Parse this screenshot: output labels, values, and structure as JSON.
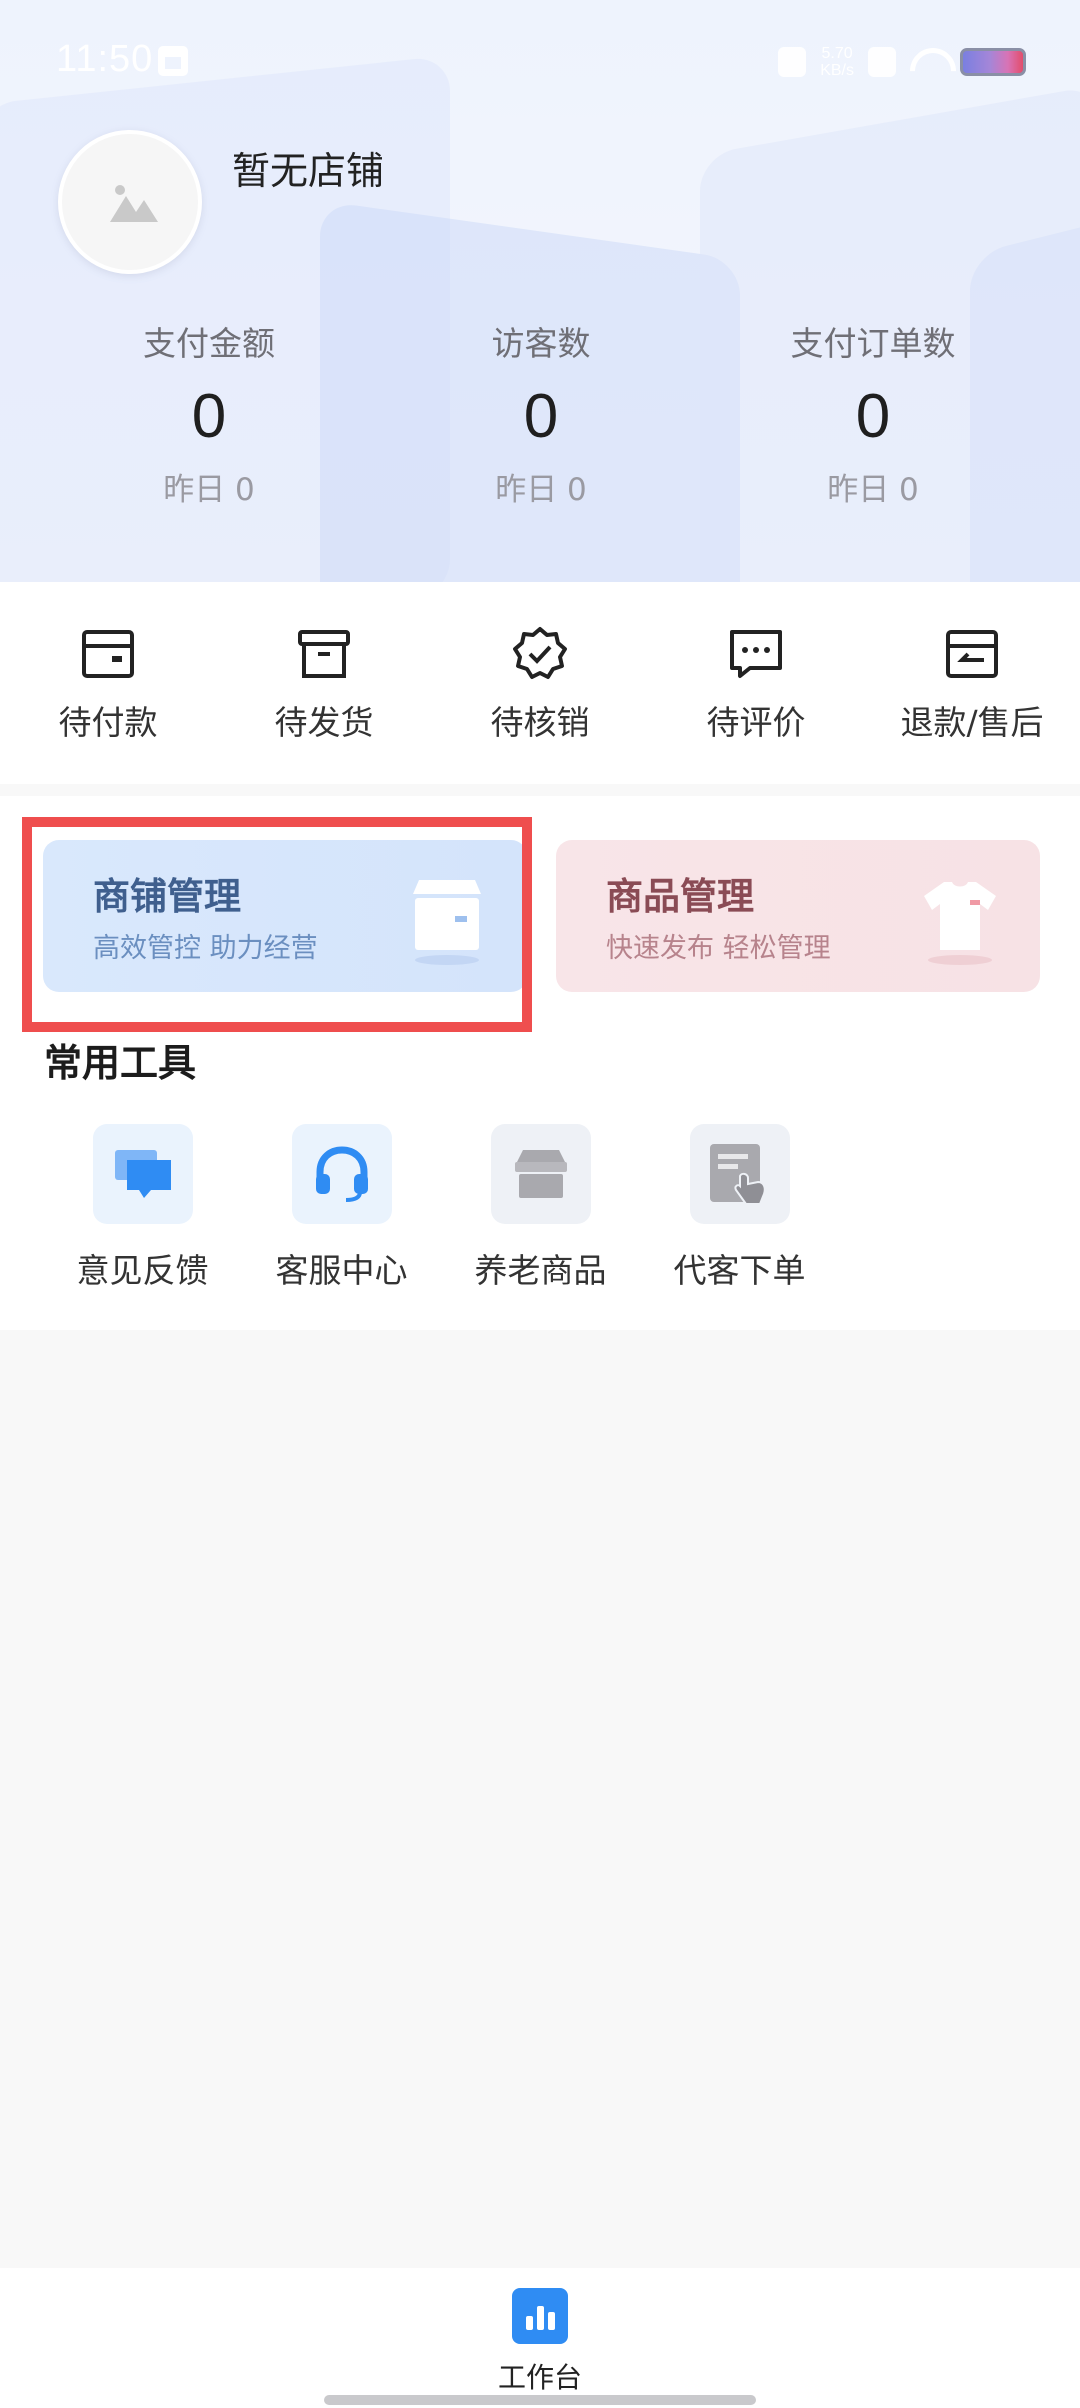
{
  "status_bar": {
    "time": "11:50",
    "net_speed_value": "5.70",
    "net_speed_unit": "KB/s"
  },
  "store": {
    "name": "暂无店铺"
  },
  "stats": [
    {
      "label": "支付金额",
      "value": "0",
      "yesterday": "昨日 0"
    },
    {
      "label": "访客数",
      "value": "0",
      "yesterday": "昨日 0"
    },
    {
      "label": "支付订单数",
      "value": "0",
      "yesterday": "昨日 0"
    }
  ],
  "orders": [
    {
      "label": "待付款",
      "icon": "wallet-icon"
    },
    {
      "label": "待发货",
      "icon": "box-icon"
    },
    {
      "label": "待核销",
      "icon": "verified-badge-icon"
    },
    {
      "label": "待评价",
      "icon": "comment-icon"
    },
    {
      "label": "退款/售后",
      "icon": "refund-icon"
    }
  ],
  "management": {
    "store_card": {
      "title": "商铺管理",
      "subtitle": "高效管控 助力经营"
    },
    "goods_card": {
      "title": "商品管理",
      "subtitle": "快速发布 轻松管理"
    }
  },
  "tools": {
    "title": "常用工具",
    "items": [
      {
        "label": "意见反馈",
        "icon": "feedback-icon"
      },
      {
        "label": "客服中心",
        "icon": "headset-icon"
      },
      {
        "label": "养老商品",
        "icon": "shop-icon"
      },
      {
        "label": "代客下单",
        "icon": "order-for-customer-icon"
      }
    ]
  },
  "bottom_nav": {
    "items": [
      {
        "label": "工作台",
        "icon": "bar-chart-icon",
        "active": true
      }
    ]
  },
  "colors": {
    "accent": "#2f8cf3",
    "highlight_border": "#ef4e4e",
    "store_card_bg": "#d9e8fc",
    "goods_card_bg": "#f8e5e8"
  }
}
